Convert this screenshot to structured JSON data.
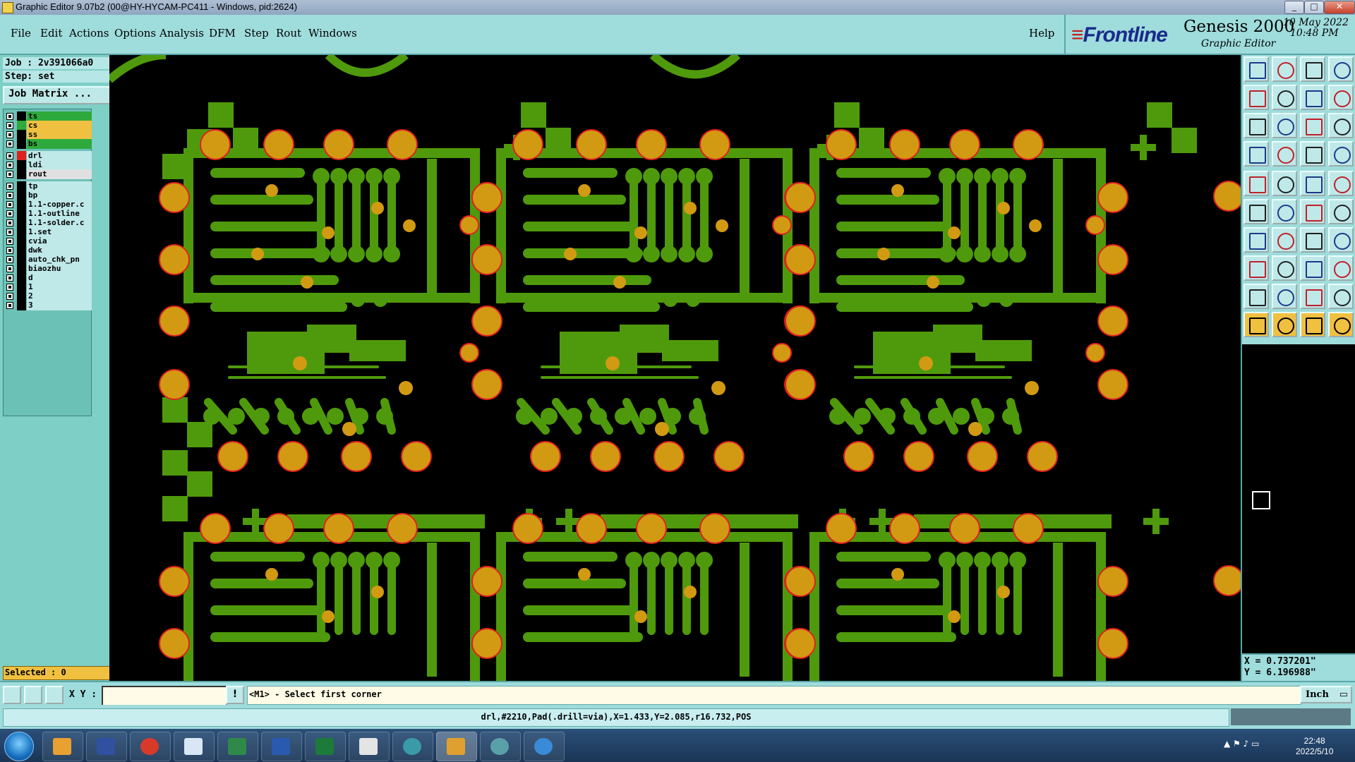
{
  "window": {
    "title": "Graphic Editor 9.07b2 (00@HY-HYCAM-PC411 - Windows, pid:2624)"
  },
  "menu": {
    "items": [
      "File",
      "Edit",
      "Actions",
      "Options",
      "Analysis",
      "DFM",
      "Step",
      "Rout",
      "Windows"
    ],
    "help": "Help"
  },
  "brand": {
    "logo": "Frontline",
    "product": "Genesis 2000",
    "subtitle": "Graphic Editor",
    "date": "10 May 2022",
    "time": "10:48 PM"
  },
  "job": {
    "job_label": "Job : 2v391066a0",
    "step_label": "Step: set",
    "matrix_button": "Job Matrix ..."
  },
  "layers": [
    {
      "name": "ts",
      "color": "#2eaa3c",
      "swatch": "#000000"
    },
    {
      "name": "cs",
      "color": "#f0c040",
      "swatch": "#2eaa3c"
    },
    {
      "name": "ss",
      "color": "#f0c040",
      "swatch": "#000000"
    },
    {
      "name": "bs",
      "color": "#2eaa3c",
      "swatch": "#000000"
    },
    {
      "name": "drl",
      "color": "#bfe8e8",
      "swatch": "#e02020"
    },
    {
      "name": "ldi",
      "color": "#bfe8e8",
      "swatch": "#000000"
    },
    {
      "name": "rout",
      "color": "#e0e0e0",
      "swatch": "#000000"
    },
    {
      "name": "tp",
      "color": "#bfe8e8",
      "swatch": "#000000"
    },
    {
      "name": "bp",
      "color": "#bfe8e8",
      "swatch": "#000000"
    },
    {
      "name": "1.1-copper.c",
      "color": "#bfe8e8",
      "swatch": "#000000"
    },
    {
      "name": "1.1-outline",
      "color": "#bfe8e8",
      "swatch": "#000000"
    },
    {
      "name": "1.1-solder.c",
      "color": "#bfe8e8",
      "swatch": "#000000"
    },
    {
      "name": "1.set",
      "color": "#bfe8e8",
      "swatch": "#000000"
    },
    {
      "name": "cvia",
      "color": "#bfe8e8",
      "swatch": "#000000"
    },
    {
      "name": "dwk",
      "color": "#bfe8e8",
      "swatch": "#000000"
    },
    {
      "name": "auto_chk_pn",
      "color": "#bfe8e8",
      "swatch": "#000000"
    },
    {
      "name": "biaozhu",
      "color": "#bfe8e8",
      "swatch": "#000000"
    },
    {
      "name": "d",
      "color": "#bfe8e8",
      "swatch": "#000000"
    },
    {
      "name": "1",
      "color": "#bfe8e8",
      "swatch": "#000000"
    },
    {
      "name": "2",
      "color": "#bfe8e8",
      "swatch": "#000000"
    },
    {
      "name": "3",
      "color": "#bfe8e8",
      "swatch": "#000000"
    }
  ],
  "selected": "Selected : 0",
  "coords": {
    "x": "X = 0.737201\"",
    "y": "Y = 6.196988\""
  },
  "command": {
    "xy_label": "X Y :",
    "xy_value": "",
    "prompt": "<M1> - Select first corner",
    "units": "Inch"
  },
  "status": "drl,#2210,Pad(.drill=via),X=1.433,Y=2.085,r16.732,POS",
  "clock": {
    "time": "22:48",
    "date": "2022/5/10"
  },
  "colors": {
    "copper": "#4f9a0c",
    "pad": "#d29a12",
    "pad_outline": "#e02020",
    "panel": "#9fdcdc"
  }
}
